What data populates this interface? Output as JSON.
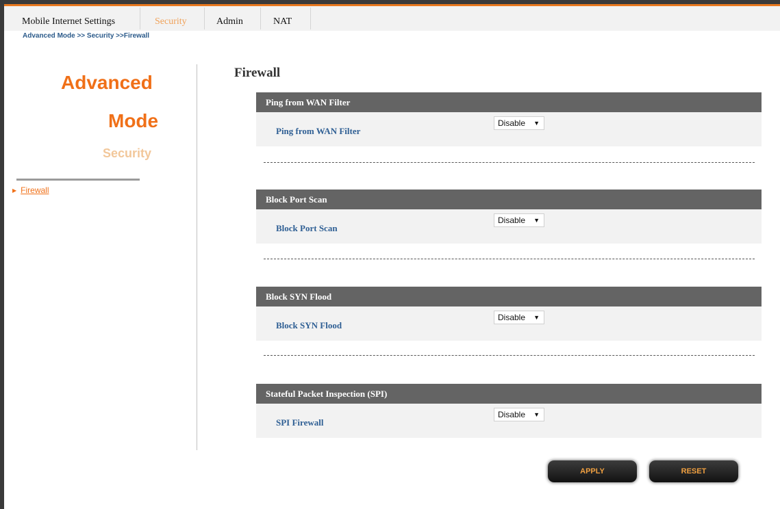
{
  "menu": {
    "tabs": [
      {
        "label": "Mobile Internet Settings"
      },
      {
        "label": "Security"
      },
      {
        "label": "Admin"
      },
      {
        "label": "NAT"
      }
    ]
  },
  "breadcrumb": "Advanced Mode >> Security >>Firewall",
  "sidebar": {
    "title_line1": "Advanced",
    "title_line2": "Mode",
    "subtitle": "Security",
    "items": [
      {
        "label": "Firewall"
      }
    ]
  },
  "main": {
    "title": "Firewall",
    "sections": [
      {
        "header": "Ping from WAN Filter",
        "label": "Ping from WAN Filter",
        "value": "Disable"
      },
      {
        "header": "Block Port Scan",
        "label": "Block Port Scan",
        "value": "Disable"
      },
      {
        "header": "Block SYN Flood",
        "label": "Block SYN Flood",
        "value": "Disable"
      },
      {
        "header": "Stateful Packet Inspection (SPI)",
        "label": "SPI Firewall",
        "value": "Disable"
      }
    ]
  },
  "buttons": {
    "apply": "APPLY",
    "reset": "RESET"
  },
  "colors": {
    "accent": "#f07018",
    "section_header": "#646464",
    "label_blue": "#2f5f94"
  }
}
